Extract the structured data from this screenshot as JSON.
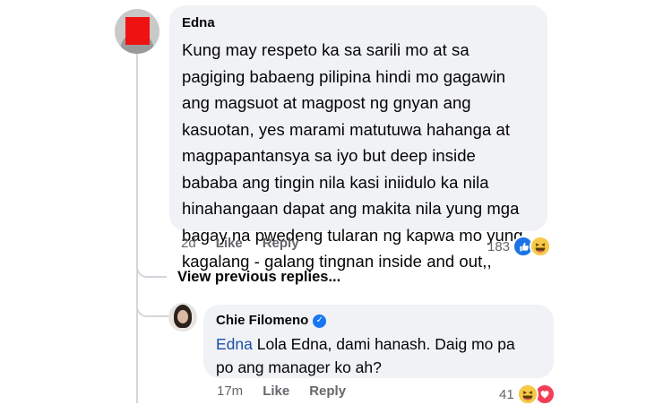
{
  "comment": {
    "author": "Edna",
    "text": "Kung may respeto ka sa sarili mo at sa\npagiging babaeng pilipina hindi mo gagawin\nang magsuot at magpost ng gnyan ang\nkasuotan, yes marami matutuwa hahanga at\nmagpapantansya sa  iyo but deep inside\nbababa ang tingin nila kasi  iniidulo ka nila\nhinahangaan dapat ang makita nila yung mga\nbagay na pwedeng tularan ng kapwa mo yung\nkagalang - galang tingnan inside and out,,",
    "time": "2d",
    "like_label": "Like",
    "reply_label": "Reply",
    "reaction_count": "183",
    "reactions": [
      "like-icon",
      "haha-icon"
    ]
  },
  "view_previous": "View previous replies...",
  "reply": {
    "author": "Chie Filomeno",
    "verified": true,
    "mention": "Edna",
    "text_line1": " Lola Edna, dami hanash. Daig mo pa",
    "text_line2": "po ang manager ko ah?",
    "time": "17m",
    "like_label": "Like",
    "reply_label": "Reply",
    "reaction_count": "41",
    "reactions": [
      "haha-icon",
      "love-icon"
    ]
  },
  "colors": {
    "bubble": "#f0f2f5",
    "mention": "#1d4fa3",
    "meta": "#65676b",
    "verified": "#1877f2"
  }
}
